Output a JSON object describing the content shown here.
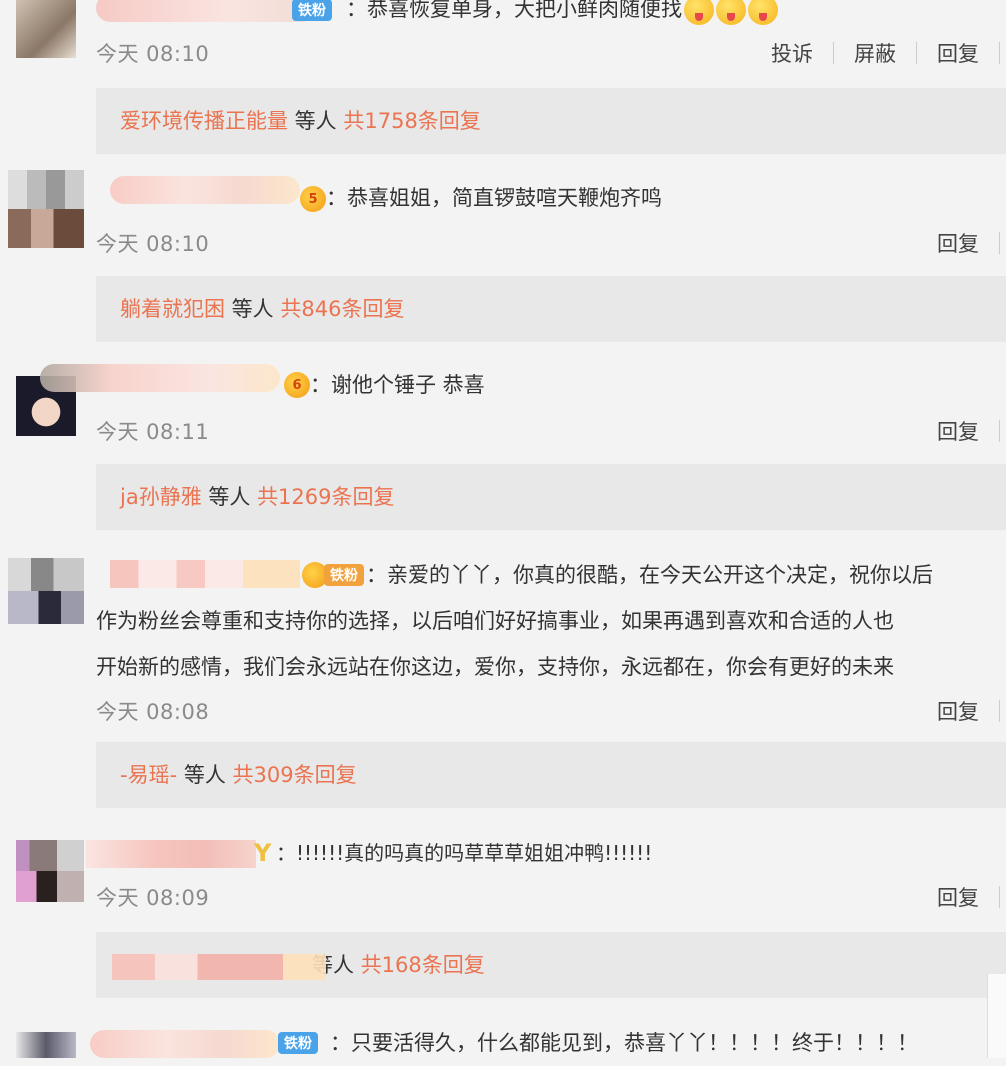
{
  "colors": {
    "accent": "#eb7350",
    "bg": "#f3f3f3",
    "reply_bg": "#e8e8e8",
    "time": "#8a8a8a"
  },
  "comments": [
    {
      "badge": "铁粉",
      "text": "：恭喜恢复单身，大把小鲜肉随便找",
      "time": "今天 08:10",
      "actions": [
        "投诉",
        "屏蔽",
        "回复"
      ],
      "reply_user": "爱环境传播正能量",
      "reply_mid": " 等人 ",
      "reply_count": "共1758条回复"
    },
    {
      "badge": "5",
      "text": "：恭喜姐姐，简直锣鼓喧天鞭炮齐鸣",
      "time": "今天 08:10",
      "actions": [
        "回复"
      ],
      "reply_user": "躺着就犯困",
      "reply_mid": " 等人 ",
      "reply_count": "共846条回复"
    },
    {
      "badge": "6",
      "text": "：谢他个锤子 恭喜",
      "time": "今天 08:11",
      "actions": [
        "回复"
      ],
      "reply_user": "ja孙静雅",
      "reply_mid": " 等人 ",
      "reply_count": "共1269条回复"
    },
    {
      "badge": "铁粉",
      "text_lines": [
        "：亲爱的丫丫，你真的很酷，在今天公开这个决定，祝你以后",
        "作为粉丝会尊重和支持你的选择，以后咱们好好搞事业，如果再遇到喜欢和合适的人也",
        "开始新的感情，我们会永远站在你这边，爱你，支持你，永远都在，你会有更好的未来"
      ],
      "time": "今天 08:08",
      "actions": [
        "回复"
      ],
      "reply_user": "-易瑶-",
      "reply_mid": " 等人 ",
      "reply_count": "共309条回复"
    },
    {
      "badge": "Y",
      "text": "：!!!!!!真的吗真的吗草草草姐姐冲鸭!!!!!!",
      "time": "今天 08:09",
      "actions": [
        "回复"
      ],
      "reply_user": "",
      "reply_mid": "等人 ",
      "reply_count": "共168条回复"
    },
    {
      "badge": "铁粉",
      "text": "：只要活得久，什么都能见到，恭喜丫丫！！！！终于！！！！"
    }
  ]
}
